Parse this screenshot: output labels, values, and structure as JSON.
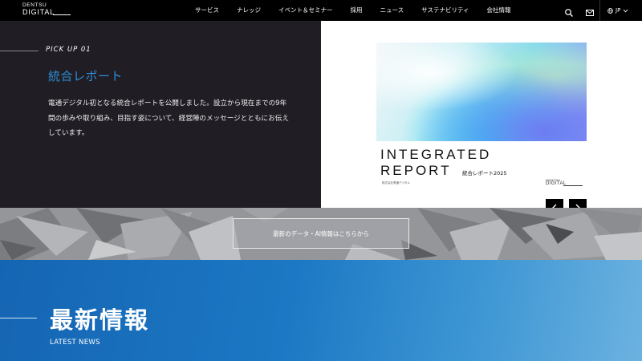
{
  "header": {
    "logo_top": "DENTSU",
    "logo_bottom": "DIGITAL",
    "nav": [
      "サービス",
      "ナレッジ",
      "イベント＆セミナー",
      "採用",
      "ニュース",
      "サステナビリティ",
      "会社情報"
    ],
    "language": "JP"
  },
  "pickup": {
    "label": "PICK UP 01",
    "title": "統合レポート",
    "description": "電通デジタル初となる統合レポートを公開しました。設立から現在までの9年間の歩みや取り組み、目指す姿について、経営陣のメッセージとともにお伝えしています。"
  },
  "report_cover": {
    "title_line1": "INTEGRATED",
    "title_line2": "REPORT",
    "subtitle": "統合レポート2025",
    "company": "株式会社電通デジタル",
    "logo_top": "DENTSU",
    "logo_bottom": "DIGITAL"
  },
  "banner": {
    "button_label": "最新のデータ・AI情報はこちらから"
  },
  "news": {
    "title": "最新情報",
    "subtitle": "LATEST NEWS"
  },
  "colors": {
    "accent_blue": "#2f8fd6",
    "hero_dark": "#201d24",
    "news_blue": "#1c78c4"
  },
  "icons": [
    "search-icon",
    "mail-icon",
    "globe-icon",
    "chevron-down-icon",
    "arrow-left-icon",
    "arrow-right-icon"
  ]
}
